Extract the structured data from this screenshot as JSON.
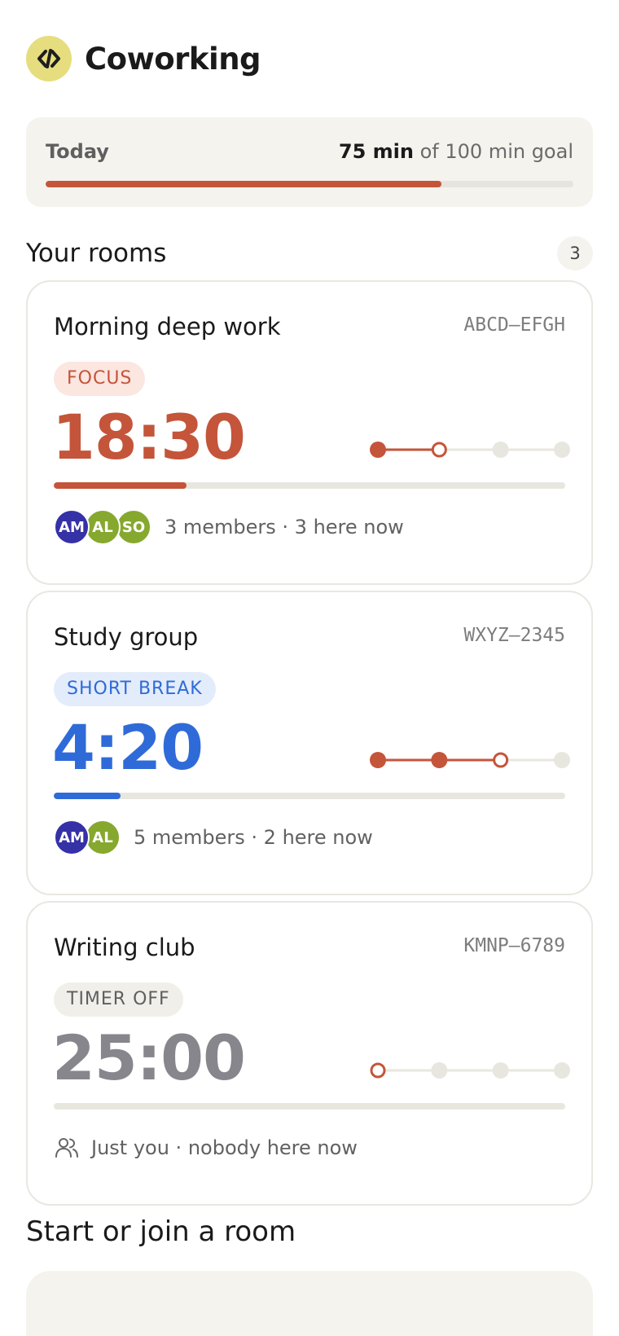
{
  "app": {
    "title": "Coworking",
    "logo_icon": "code-bracket-icon"
  },
  "today": {
    "label": "Today",
    "minutes": "75 min",
    "goal_text": "of 100 min goal",
    "progress_fraction": 0.75,
    "accent": "#c4553a"
  },
  "rooms": {
    "title": "Your rooms",
    "count": "3",
    "items": [
      {
        "name": "Morning deep work",
        "code": "ABCD–EFGH",
        "status": "FOCUS",
        "status_color": "#c4553a",
        "status_bg": "#fbe6e0",
        "timer": "18:30",
        "timer_color": "#c4553a",
        "progress_fraction": 0.26,
        "sessions": [
          "done",
          "current",
          "upcoming",
          "upcoming"
        ],
        "avatars": [
          {
            "initials": "AM",
            "color": "#3531a6"
          },
          {
            "initials": "AL",
            "color": "#86a82e"
          },
          {
            "initials": "SO",
            "color": "#86a82e"
          }
        ],
        "footer": "3 members · 3 here now"
      },
      {
        "name": "Study group",
        "code": "WXYZ–2345",
        "status": "SHORT BREAK",
        "status_color": "#2f6bd8",
        "status_bg": "#e3ecfb",
        "timer": "4:20",
        "timer_color": "#2f6bd8",
        "progress_fraction": 0.13,
        "sessions": [
          "done",
          "done",
          "current",
          "upcoming"
        ],
        "avatars": [
          {
            "initials": "AM",
            "color": "#3531a6"
          },
          {
            "initials": "AL",
            "color": "#86a82e"
          }
        ],
        "footer": "5 members · 2 here now"
      },
      {
        "name": "Writing club",
        "code": "KMNP–6789",
        "status": "TIMER OFF",
        "status_color": "#5f5f5f",
        "status_bg": "#f0efea",
        "timer": "25:00",
        "timer_color": "#86868c",
        "progress_fraction": 0,
        "sessions": [
          "current",
          "upcoming",
          "upcoming",
          "upcoming"
        ],
        "avatars": [],
        "footer_icon": "people-icon",
        "footer": "Just you · nobody here now"
      }
    ]
  },
  "start": {
    "title": "Start or join a room"
  }
}
